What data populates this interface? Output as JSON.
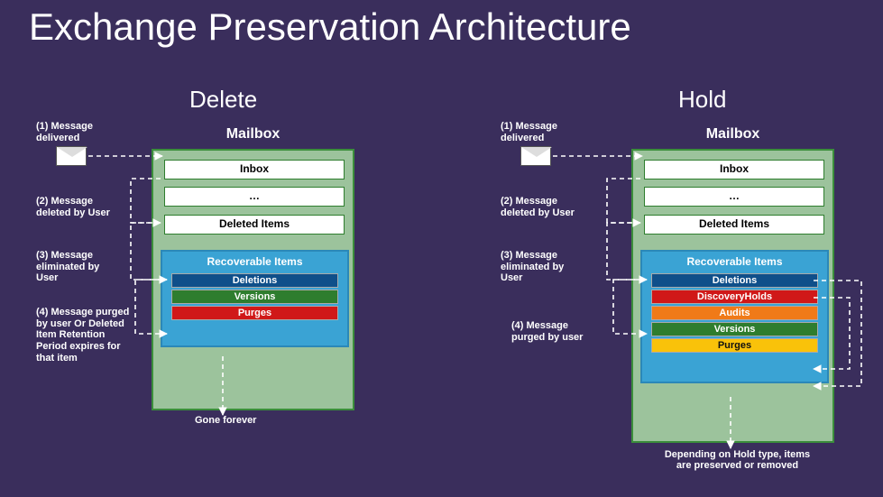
{
  "title": "Exchange Preservation Architecture",
  "sections": {
    "delete": "Delete",
    "hold": "Hold"
  },
  "mailbox_label": "Mailbox",
  "folders": {
    "inbox": "Inbox",
    "dots": "…",
    "deleted": "Deleted Items"
  },
  "recoverable": {
    "title": "Recoverable Items",
    "deletions": "Deletions",
    "versions": "Versions",
    "purges": "Purges",
    "discovery": "DiscoveryHolds",
    "audits": "Audits"
  },
  "labels": {
    "l1": "(1) Message delivered",
    "l2": "(2) Message deleted by User",
    "l3": "(3) Message eliminated by User",
    "l4_left": "(4) Message purged by user Or Deleted Item Retention Period expires for that item",
    "l4_right": "(4) Message purged by user"
  },
  "footers": {
    "gone": "Gone forever",
    "depends": "Depending on Hold type, items are preserved or removed"
  }
}
